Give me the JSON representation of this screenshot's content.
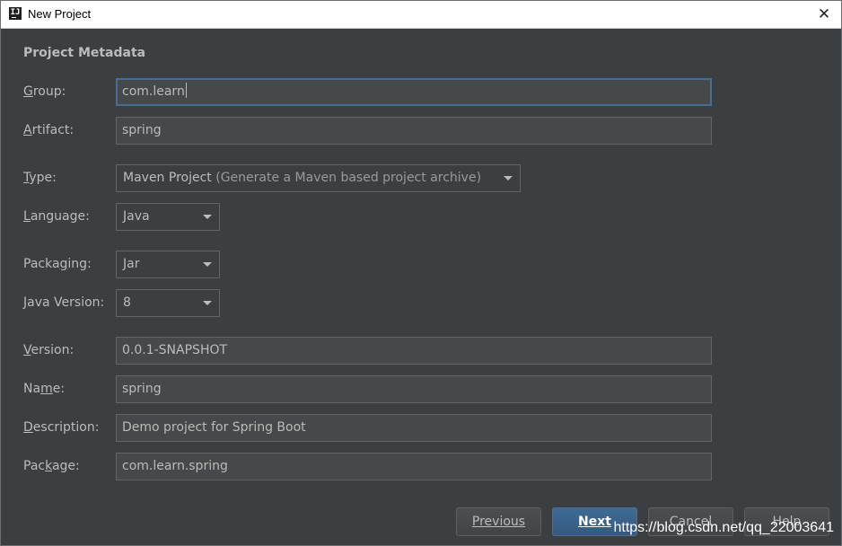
{
  "window": {
    "title": "New Project",
    "icon_text": "IJ",
    "close_glyph": "✕"
  },
  "section": {
    "title": "Project Metadata"
  },
  "fields": {
    "group": {
      "label_mnemonic": "G",
      "label_rest": "roup:",
      "value": "com.learn"
    },
    "artifact": {
      "label_mnemonic": "A",
      "label_rest": "rtifact:",
      "value": "spring"
    },
    "type": {
      "label_mnemonic": "T",
      "label_rest": "ype:",
      "value": "Maven Project",
      "hint": "(Generate a Maven based project archive)"
    },
    "language": {
      "label_pre": "",
      "label_mnemonic": "L",
      "label_rest": "anguage:",
      "value": "Java"
    },
    "packaging": {
      "label_pre": "Packa",
      "label_mnemonic": "g",
      "label_rest": "ing:",
      "value": "Jar"
    },
    "java_version": {
      "label_mnemonic": "J",
      "label_rest": "ava Version:",
      "value": "8"
    },
    "version": {
      "label_mnemonic": "V",
      "label_rest": "ersion:",
      "value": "0.0.1-SNAPSHOT"
    },
    "name": {
      "label_pre": "Na",
      "label_mnemonic": "m",
      "label_rest": "e:",
      "value": "spring"
    },
    "description": {
      "label_mnemonic": "D",
      "label_rest": "escription:",
      "value": "Demo project for Spring Boot"
    },
    "package": {
      "label_pre": "Pac",
      "label_mnemonic": "k",
      "label_rest": "age:",
      "value": "com.learn.spring"
    }
  },
  "buttons": {
    "previous": "Previous",
    "next": "Next",
    "cancel": "Cancel",
    "help": "Help"
  },
  "watermark": "https://blog.csdn.net/qq_22003641",
  "colors": {
    "background": "#3c3f41",
    "field_bg": "#45494a",
    "text": "#bbbbbb",
    "focus_border": "#466d94",
    "primary_button": "#365880"
  }
}
